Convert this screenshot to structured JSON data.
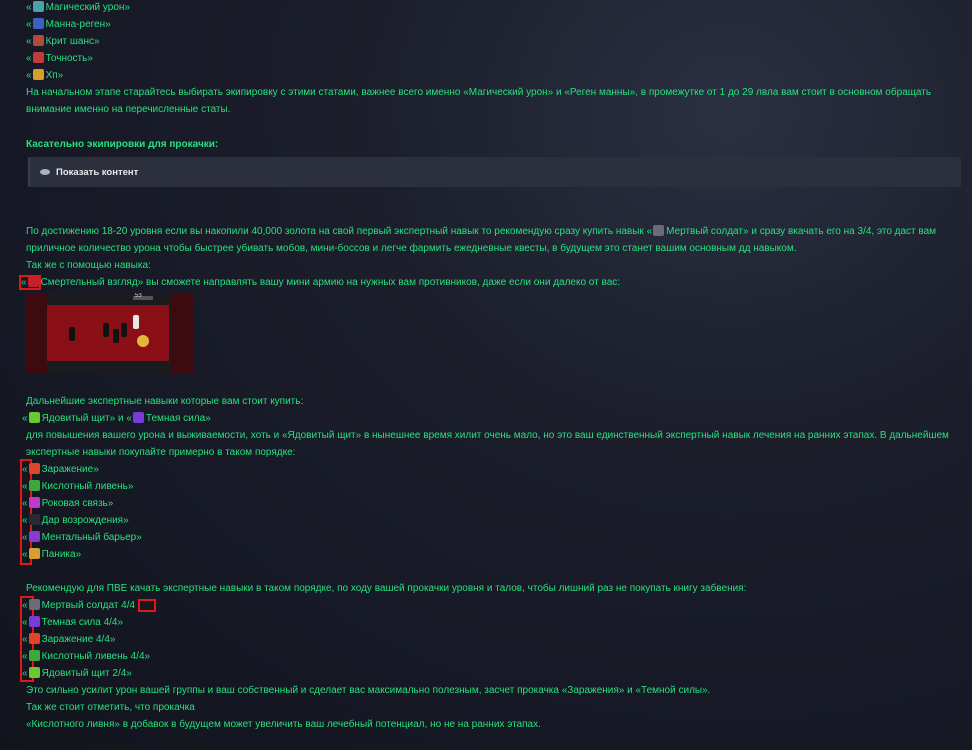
{
  "stats": [
    {
      "label": "Магический урон",
      "icon": "magic-damage-icon",
      "color": "#4aa3a8"
    },
    {
      "label": "Манна-реген",
      "icon": "mana-regen-icon",
      "color": "#3a62c2"
    },
    {
      "label": "Крит шанс",
      "icon": "crit-chance-icon",
      "color": "#b04a3a"
    },
    {
      "label": "Точность",
      "icon": "accuracy-icon",
      "color": "#c03c3c"
    },
    {
      "label": "Хп",
      "icon": "hp-icon",
      "color": "#d4a02a"
    }
  ],
  "open_quote": "«",
  "close_quote": "»",
  "intro_text": "На начальном этапе старайтесь выбирать экипировку с этими статами, важнее всего именно «Магический урон» и «Реген манны», в промежутке от 1 до 29 лвла вам стоит в основном обращать внимание именно на перечисленные статы.",
  "equip_heading": "Касательно экипировки для прокачки:",
  "spoiler_label": "Показать контент",
  "para_1": "По достижению 18-20 уровня если вы накопили 40,000 золота на свой первый экспертный навык то рекомендую сразу купить навык «",
  "dead_soldier_label": "Мертвый солдат",
  "para_1b": "» и сразу вкачать его на 3/4, это даст вам приличное количество урона чтобы быстрее убивать мобов, мини-боссов и легче фармить ежедневные квесты, в будущем это станет вашим основным дд навыком.",
  "also_skill": "Так же с помощью навыка:",
  "death_gaze_text": "Смертельный взгляд» вы сможете направлять вашу мини армию на нужных вам противников, даже если они далеко от вас:",
  "screenshot_level": "53",
  "further_text": "Дальнейшие экспертные навыки которые вам стоит купить:",
  "poison_shield": "Ядовитый щит",
  "and_word": " и ",
  "dark_power": "Темная сила",
  "para_2": "для повышения вашего урона и выживаемости, хоть и «Ядовитый щит» в нынешнее время хилит очень мало, но это ваш единственный экспертный навык лечения на ранних этапах. В дальнейшем экспертные навыки покупайте примерно в таком порядке:",
  "order_list": [
    {
      "label": "Заражение»",
      "icon": "infection-icon",
      "color": "#e0462a"
    },
    {
      "label": "Кислотный ливень»",
      "icon": "acid-rain-icon",
      "color": "#3fa83a"
    },
    {
      "label": "Роковая связь»",
      "icon": "fatal-link-icon",
      "color": "#c43ac8"
    },
    {
      "label": "Дар возрождения»",
      "icon": "rebirth-gift-icon",
      "color": "#2a2a34"
    },
    {
      "label": "Ментальный барьер»",
      "icon": "mental-barrier-icon",
      "color": "#8a3ad0"
    },
    {
      "label": "Паника»",
      "icon": "panic-icon",
      "color": "#d6a030"
    }
  ],
  "pve_text": "Рекомендую для ПВЕ качать экспертные навыки в таком порядке, по ходу вашей прокачки уровня и талов, чтобы лишний раз не покупать книгу забвения:",
  "pve_list": [
    {
      "label": "Мертвый солдат 4/4",
      "icon": "dead-soldier-icon",
      "color": "#6a6a78"
    },
    {
      "label": "Темная сила 4/4»",
      "icon": "dark-power-icon",
      "color": "#7a3ad8"
    },
    {
      "label": "Заражение 4/4»",
      "icon": "infection-icon",
      "color": "#e0462a"
    },
    {
      "label": "Кислотный ливень 4/4»",
      "icon": "acid-rain-icon",
      "color": "#3fa83a"
    },
    {
      "label": "Ядовитый щит 2/4»",
      "icon": "poison-shield-icon",
      "color": "#6ac830"
    }
  ],
  "final_1": "Это сильно усилит урон вашей группы и ваш собственный и сделает вас максимально полезным, засчет прокачка «Заражения» и «Темной силы».",
  "final_2": "Так же стоит отметить, что прокачка",
  "final_3": "«Кислотного ливня» в добавок в будущем может увеличить ваш лечебный потенциал, но не на ранних этапах."
}
